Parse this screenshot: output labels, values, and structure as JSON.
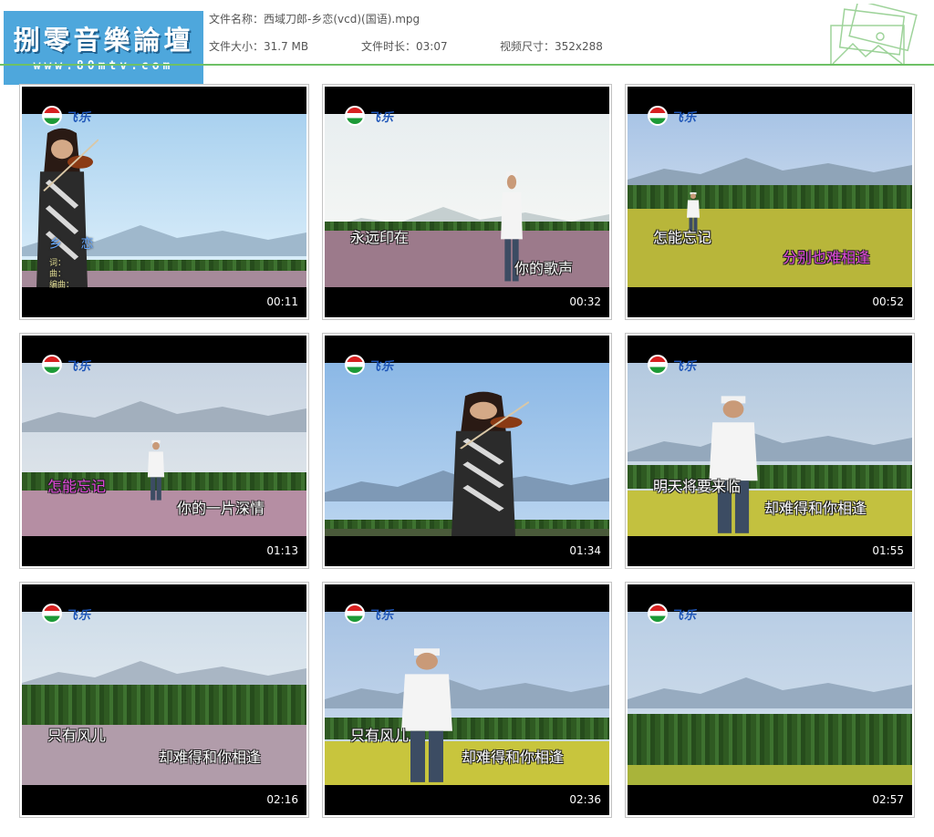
{
  "logo": {
    "title": "捌零音樂論壇",
    "url": "www.80mtv.com"
  },
  "file_info": {
    "name_label": "文件名称：",
    "name_value": "西域刀郎-乡恋(vcd)(国语).mpg",
    "size_label": "文件大小：",
    "size_value": "31.7 MB",
    "duration_label": "文件时长：",
    "duration_value": "03:07",
    "resolution_label": "视频尺寸：",
    "resolution_value": "352x288"
  },
  "colors": {
    "header_line": "#6ec166",
    "logo_bg": "#4ea7dc",
    "lyric_highlight": "#e04ad9"
  },
  "icons": {
    "header": "image-gallery-icon",
    "channel": "tv-channel-logo-icon"
  },
  "channel_logo_text": "飞乐",
  "thumbnails": [
    {
      "timestamp": "00:11",
      "song_title": "乡 恋",
      "credits": [
        "词：",
        "曲：",
        "编曲："
      ],
      "lyric_left": "",
      "lyric_right": ""
    },
    {
      "timestamp": "00:32",
      "lyric_left": "永远印在",
      "lyric_right": "你的歌声"
    },
    {
      "timestamp": "00:52",
      "lyric_left": "怎能忘记",
      "lyric_right": "分别也难相逢"
    },
    {
      "timestamp": "01:13",
      "lyric_left": "怎能忘记",
      "lyric_right": "你的一片深情"
    },
    {
      "timestamp": "01:34",
      "lyric_left": "",
      "lyric_right": ""
    },
    {
      "timestamp": "01:55",
      "lyric_left": "明天将要来临",
      "lyric_right": "却难得和你相逢"
    },
    {
      "timestamp": "02:16",
      "lyric_left": "只有风儿",
      "lyric_right": "却难得和你相逢"
    },
    {
      "timestamp": "02:36",
      "lyric_left": "只有风儿",
      "lyric_right": "却难得和你相逢"
    },
    {
      "timestamp": "02:57",
      "lyric_left": "",
      "lyric_right": ""
    }
  ]
}
